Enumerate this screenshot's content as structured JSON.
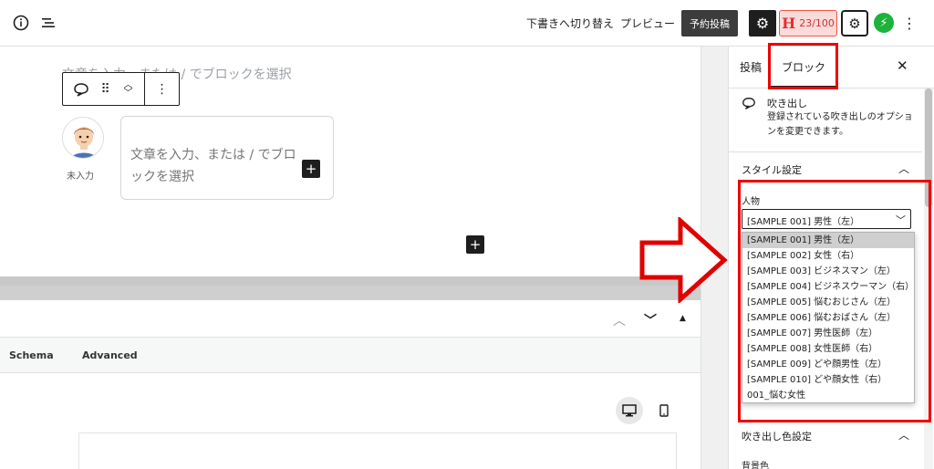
{
  "toolbar": {
    "info_icon": "info-icon",
    "list_icon": "list-view-icon",
    "switch_draft_label": "下書きへ切り替え",
    "preview_label": "プレビュー",
    "schedule_label": "予約投稿",
    "seo_letter": "H",
    "seo_score": "23/100"
  },
  "editor": {
    "ghost_text": "文章を入力、または / でブロックを選択",
    "avatar_label": "未入力",
    "bubble_placeholder": "文章を入力、または / でブロックを選択",
    "plus_symbol": "+",
    "block_toolbar": {
      "icons": [
        "speech-bubble-icon",
        "drag-handle-icon",
        "move-icon",
        "more-options-icon"
      ]
    }
  },
  "meta_box": {
    "tabs": [
      "Schema",
      "Advanced"
    ]
  },
  "sidebar": {
    "tab_post": "投稿",
    "tab_block": "ブロック",
    "block_name": "吹き出し",
    "block_description": "登録されている吹き出しのオプションを変更できます。",
    "style_section": "スタイル設定",
    "person_label": "人物",
    "selected_person": "[SAMPLE 001] 男性（左）",
    "options": [
      "[SAMPLE 001] 男性（左）",
      "[SAMPLE 002] 女性（右）",
      "[SAMPLE 003] ビジネスマン（左）",
      "[SAMPLE 004] ビジネスウーマン（右）",
      "[SAMPLE 005] 悩むおじさん（左）",
      "[SAMPLE 006] 悩むおばさん（左）",
      "[SAMPLE 007] 男性医師（左）",
      "[SAMPLE 008] 女性医師（右）",
      "[SAMPLE 009] どや顔男性（左）",
      "[SAMPLE 010] どや顔女性（右）",
      "001_悩む女性"
    ],
    "color_section": "吹き出し色設定",
    "bg_color_label": "背景色"
  },
  "colors": {
    "highlight": "#e00000",
    "seo_badge_bg": "#fbdada",
    "bolt_green": "#1cb33a",
    "dark": "#1e1e1e"
  }
}
